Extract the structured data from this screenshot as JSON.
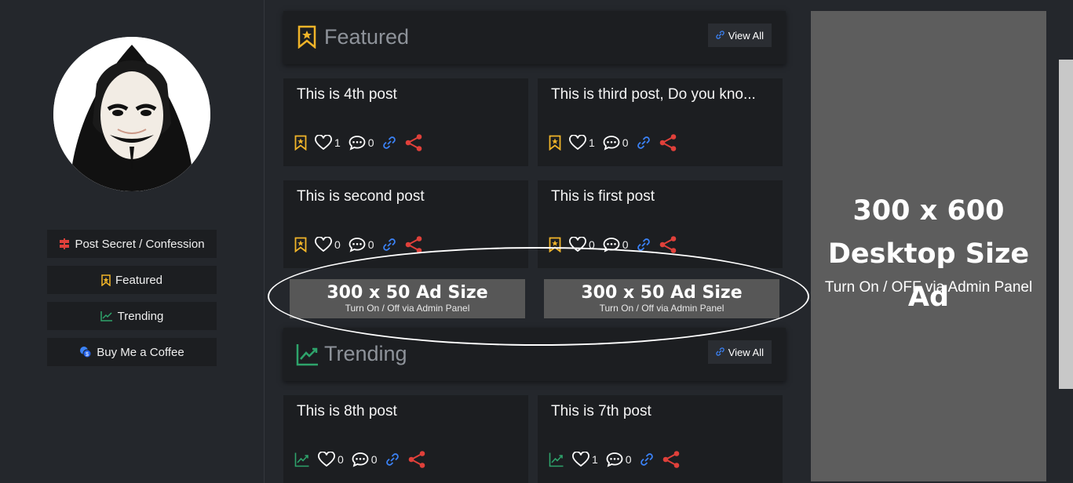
{
  "sidebar": {
    "avatar_alt": "Guy Fawkes mask avatar",
    "buttons": [
      {
        "label": "Post Secret / Confession",
        "icon": "signpost-icon"
      },
      {
        "label": "Featured",
        "icon": "bookmark-star-icon"
      },
      {
        "label": "Trending",
        "icon": "trending-icon"
      },
      {
        "label": "Buy Me a Coffee",
        "icon": "coins-icon"
      }
    ]
  },
  "featured": {
    "title": "Featured",
    "view_all": "View All",
    "posts": [
      {
        "title": "This is 4th post",
        "likes": "1",
        "comments": "0"
      },
      {
        "title": "This is third post, Do you kno...",
        "likes": "1",
        "comments": "0"
      },
      {
        "title": "This is second post",
        "likes": "0",
        "comments": "0"
      },
      {
        "title": "This is first post",
        "likes": "0",
        "comments": "0"
      }
    ]
  },
  "ads": {
    "small": [
      {
        "title": "300 x 50 Ad Size",
        "subtitle": "Turn On / Off via Admin Panel"
      },
      {
        "title": "300 x 50 Ad Size",
        "subtitle": "Turn On / Off via Admin Panel"
      }
    ],
    "big": {
      "line1": "300 x 600",
      "line2": "Desktop Size Ad",
      "subtitle": "Turn On / OFF via Admin Panel"
    }
  },
  "trending": {
    "title": "Trending",
    "view_all": "View All",
    "posts": [
      {
        "title": "This is 8th post",
        "likes": "0",
        "comments": "0"
      },
      {
        "title": "This is 7th post",
        "likes": "1",
        "comments": "0"
      }
    ]
  },
  "colors": {
    "background": "#24272c",
    "card": "#1c1e21",
    "gold": "#f0b429",
    "red": "#e0403a",
    "blue": "#3b82f6",
    "green": "#2ea36b"
  }
}
